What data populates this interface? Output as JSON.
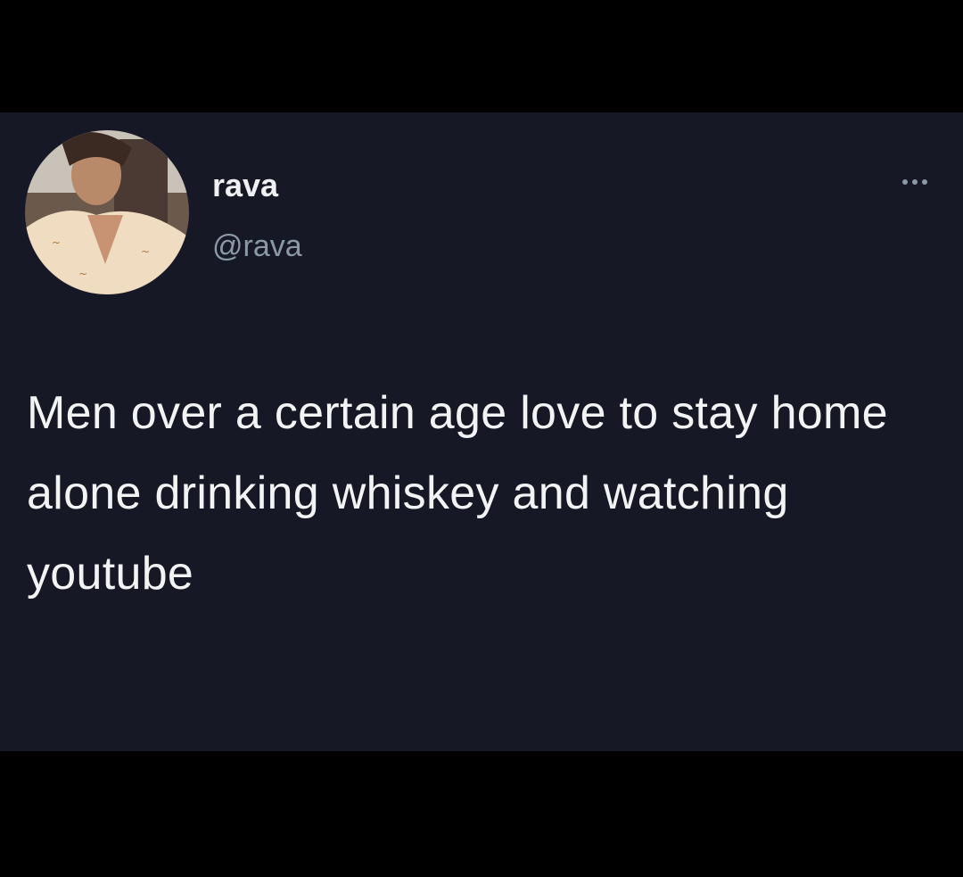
{
  "tweet": {
    "display_name": "rava",
    "handle": "@rava",
    "text": "Men over a certain age love to stay home alone drinking whiskey and watching youtube",
    "more_icon": "more-horizontal-icon"
  },
  "colors": {
    "background": "#000000",
    "card": "#171825",
    "name": "#eef0f3",
    "handle": "#8b98a5",
    "text": "#f2f3f5"
  }
}
